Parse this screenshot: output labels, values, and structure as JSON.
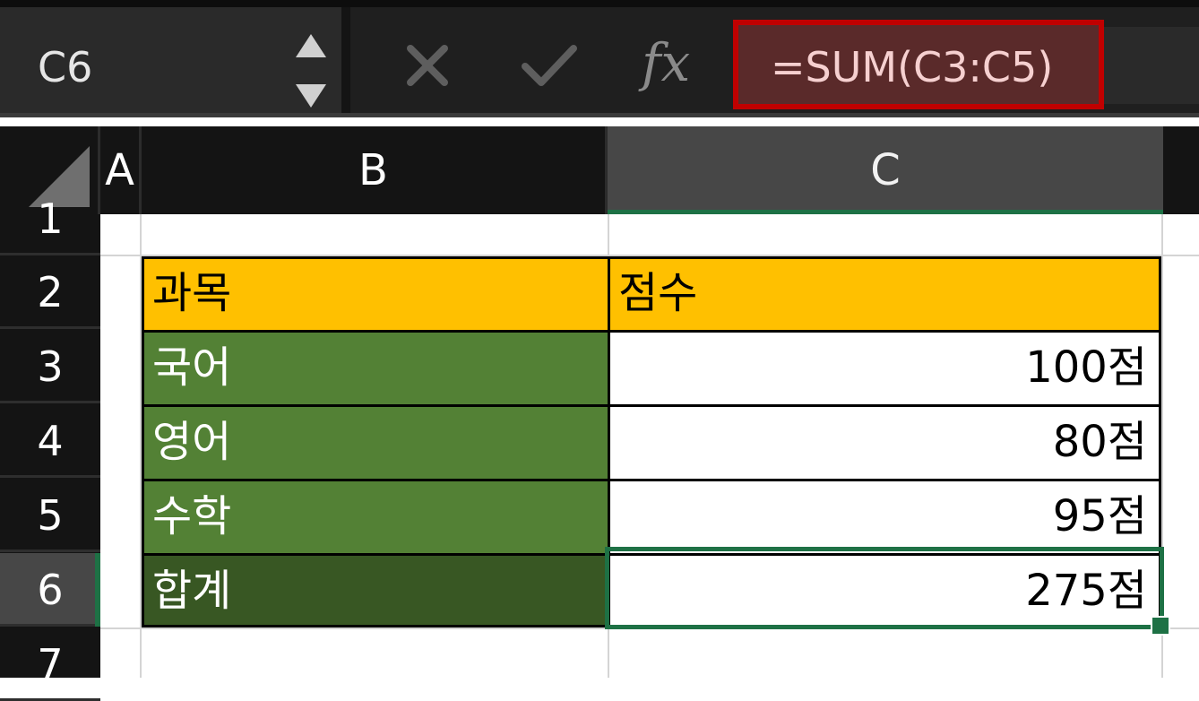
{
  "formula_bar": {
    "name_box": "C6",
    "fx_label": "fx",
    "formula": "=SUM(C3:C5)"
  },
  "icons": {
    "name_box_arrows": "up-down-arrows-icon",
    "cancel": "close-icon",
    "enter": "check-icon",
    "insert_function": "fx-icon"
  },
  "columns": [
    "A",
    "B",
    "C"
  ],
  "rows": [
    "1",
    "2",
    "3",
    "4",
    "5",
    "6",
    "7"
  ],
  "table": {
    "header": {
      "subject": "과목",
      "score": "점수"
    },
    "rows": [
      {
        "subject": "국어",
        "score": "100점"
      },
      {
        "subject": "영어",
        "score": "80점"
      },
      {
        "subject": "수학",
        "score": "95점"
      },
      {
        "subject": "합계",
        "score": "275점"
      }
    ]
  },
  "selection": {
    "active_cell": "C6"
  },
  "colors": {
    "header_fill": "#ffc000",
    "subject_fill": "#538135",
    "total_fill": "#385723",
    "selection": "#1e7145",
    "formula_highlight_border": "#c00000"
  }
}
